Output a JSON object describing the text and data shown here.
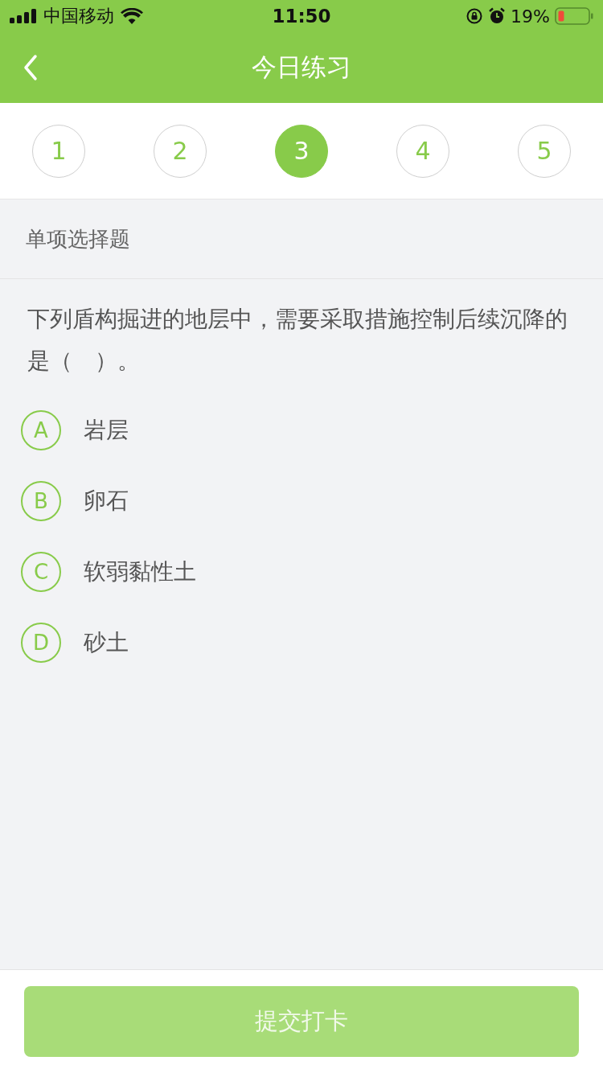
{
  "status_bar": {
    "carrier": "中国移动",
    "time": "11:50",
    "battery": "19%"
  },
  "nav": {
    "title": "今日练习"
  },
  "steps": [
    {
      "label": "1",
      "selected": false
    },
    {
      "label": "2",
      "selected": false
    },
    {
      "label": "3",
      "selected": true
    },
    {
      "label": "4",
      "selected": false
    },
    {
      "label": "5",
      "selected": false
    }
  ],
  "question_type": "单项选择题",
  "question": "下列盾构掘进的地层中，需要采取措施控制后续沉降的是（　）。",
  "options": [
    {
      "letter": "A",
      "text": "岩层",
      "selected": false
    },
    {
      "letter": "B",
      "text": "卵石",
      "selected": false
    },
    {
      "letter": "C",
      "text": "软弱黏性土",
      "selected": false
    },
    {
      "letter": "D",
      "text": "砂土",
      "selected": false
    }
  ],
  "submit": {
    "label": "提交打卡",
    "disabled": true
  }
}
